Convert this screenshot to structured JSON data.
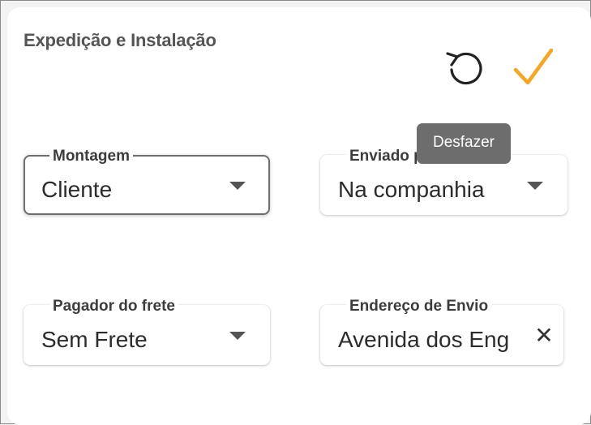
{
  "header": {
    "title": "Expedição e Instalação",
    "undo_icon": "undo-icon",
    "confirm_icon": "check-icon",
    "confirm_color": "#f5a623"
  },
  "tooltip": {
    "text": "Desfazer"
  },
  "fields": {
    "montagem": {
      "label": "Montagem",
      "value": "Cliente"
    },
    "enviado_para": {
      "label": "Enviado para",
      "value": "Na companhia"
    },
    "pagador_frete": {
      "label": "Pagador do frete",
      "value": "Sem Frete"
    },
    "endereco_envio": {
      "label": "Endereço de Envio",
      "value": "Avenida dos Eng",
      "clear": "✕"
    }
  }
}
